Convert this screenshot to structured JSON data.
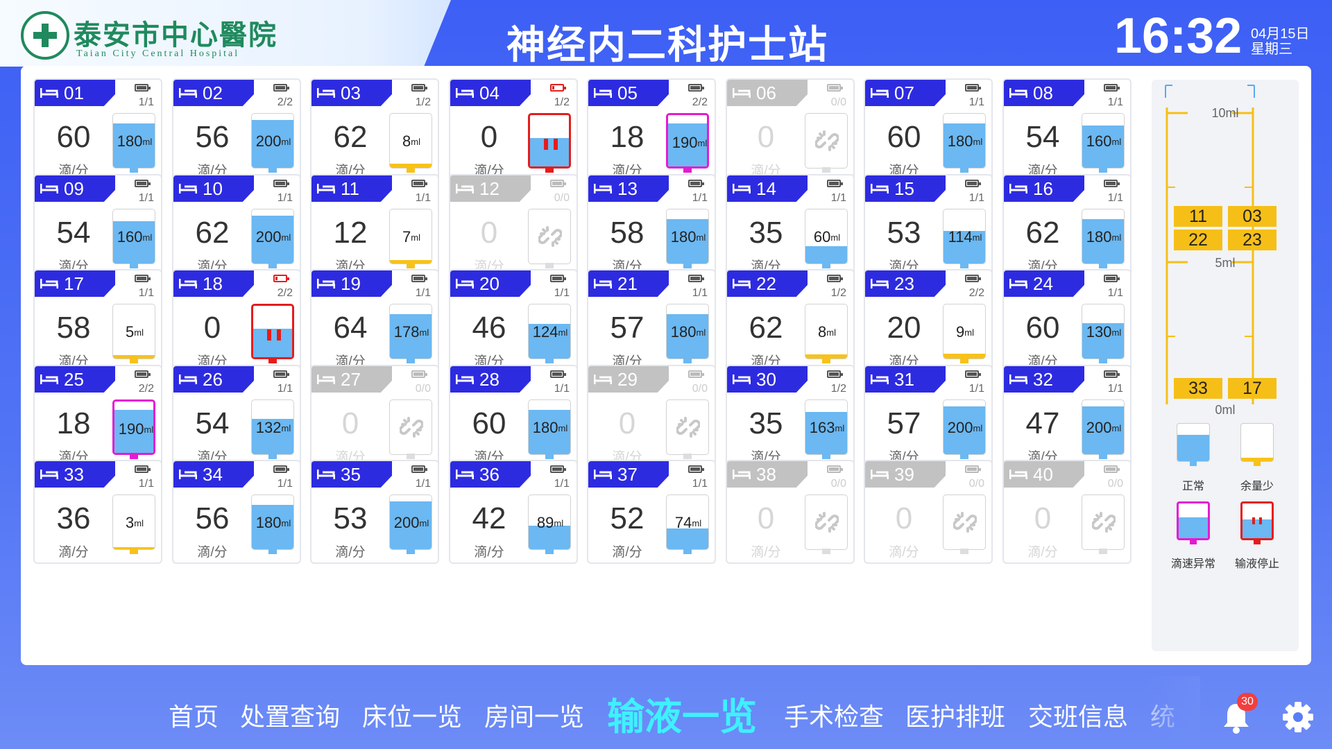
{
  "header": {
    "hospital_cn": "泰安市中心醫院",
    "hospital_en": "Taian City Central Hospital",
    "station": "神经内二科护士站",
    "time": "16:32",
    "date": "04月15日",
    "weekday": "星期三"
  },
  "rate_unit": "滴/分",
  "vol_unit": "ml",
  "beds": [
    {
      "no": "01",
      "frac": "1/1",
      "rate": "60",
      "vol": "180",
      "level": 0.82,
      "state": "normal",
      "battery": "ok"
    },
    {
      "no": "02",
      "frac": "2/2",
      "rate": "56",
      "vol": "200",
      "level": 0.88,
      "state": "normal",
      "battery": "ok"
    },
    {
      "no": "03",
      "frac": "1/2",
      "rate": "62",
      "vol": "8",
      "level": 0.08,
      "state": "low",
      "battery": "ok"
    },
    {
      "no": "04",
      "frac": "1/2",
      "rate": "0",
      "vol": "",
      "level": 0.55,
      "state": "stopped",
      "battery": "low"
    },
    {
      "no": "05",
      "frac": "2/2",
      "rate": "18",
      "vol": "190",
      "level": 0.84,
      "state": "abnormal",
      "battery": "ok"
    },
    {
      "no": "06",
      "frac": "0/0",
      "rate": "0",
      "vol": "",
      "level": 0,
      "state": "unbound",
      "battery": "off"
    },
    {
      "no": "07",
      "frac": "1/1",
      "rate": "60",
      "vol": "180",
      "level": 0.82,
      "state": "normal",
      "battery": "ok"
    },
    {
      "no": "08",
      "frac": "1/1",
      "rate": "54",
      "vol": "160",
      "level": 0.78,
      "state": "normal",
      "battery": "ok"
    },
    {
      "no": "09",
      "frac": "1/1",
      "rate": "54",
      "vol": "160",
      "level": 0.78,
      "state": "normal",
      "battery": "ok"
    },
    {
      "no": "10",
      "frac": "1/1",
      "rate": "62",
      "vol": "200",
      "level": 0.88,
      "state": "normal",
      "battery": "ok"
    },
    {
      "no": "11",
      "frac": "1/1",
      "rate": "12",
      "vol": "7",
      "level": 0.07,
      "state": "low",
      "battery": "ok"
    },
    {
      "no": "12",
      "frac": "0/0",
      "rate": "0",
      "vol": "",
      "level": 0,
      "state": "unbound",
      "battery": "off"
    },
    {
      "no": "13",
      "frac": "1/1",
      "rate": "58",
      "vol": "180",
      "level": 0.82,
      "state": "normal",
      "battery": "ok"
    },
    {
      "no": "14",
      "frac": "1/1",
      "rate": "35",
      "vol": "60",
      "level": 0.32,
      "state": "normal",
      "battery": "ok"
    },
    {
      "no": "15",
      "frac": "1/1",
      "rate": "53",
      "vol": "114",
      "level": 0.6,
      "state": "normal",
      "battery": "ok"
    },
    {
      "no": "16",
      "frac": "1/1",
      "rate": "62",
      "vol": "180",
      "level": 0.82,
      "state": "normal",
      "battery": "ok"
    },
    {
      "no": "17",
      "frac": "1/1",
      "rate": "58",
      "vol": "5",
      "level": 0.06,
      "state": "low",
      "battery": "ok"
    },
    {
      "no": "18",
      "frac": "2/2",
      "rate": "0",
      "vol": "",
      "level": 0.55,
      "state": "stopped",
      "battery": "low"
    },
    {
      "no": "19",
      "frac": "1/1",
      "rate": "64",
      "vol": "178",
      "level": 0.82,
      "state": "normal",
      "battery": "ok"
    },
    {
      "no": "20",
      "frac": "1/1",
      "rate": "46",
      "vol": "124",
      "level": 0.64,
      "state": "normal",
      "battery": "ok"
    },
    {
      "no": "21",
      "frac": "1/1",
      "rate": "57",
      "vol": "180",
      "level": 0.82,
      "state": "normal",
      "battery": "ok"
    },
    {
      "no": "22",
      "frac": "1/2",
      "rate": "62",
      "vol": "8",
      "level": 0.08,
      "state": "low",
      "battery": "ok"
    },
    {
      "no": "23",
      "frac": "2/2",
      "rate": "20",
      "vol": "9",
      "level": 0.09,
      "state": "low",
      "battery": "ok"
    },
    {
      "no": "24",
      "frac": "1/1",
      "rate": "60",
      "vol": "130",
      "level": 0.66,
      "state": "normal",
      "battery": "ok"
    },
    {
      "no": "25",
      "frac": "2/2",
      "rate": "18",
      "vol": "190",
      "level": 0.84,
      "state": "abnormal",
      "battery": "ok"
    },
    {
      "no": "26",
      "frac": "1/1",
      "rate": "54",
      "vol": "132",
      "level": 0.66,
      "state": "normal",
      "battery": "ok"
    },
    {
      "no": "27",
      "frac": "0/0",
      "rate": "0",
      "vol": "",
      "level": 0,
      "state": "unbound",
      "battery": "off"
    },
    {
      "no": "28",
      "frac": "1/1",
      "rate": "60",
      "vol": "180",
      "level": 0.82,
      "state": "normal",
      "battery": "ok"
    },
    {
      "no": "29",
      "frac": "0/0",
      "rate": "0",
      "vol": "",
      "level": 0,
      "state": "unbound",
      "battery": "off"
    },
    {
      "no": "30",
      "frac": "1/2",
      "rate": "35",
      "vol": "163",
      "level": 0.78,
      "state": "normal",
      "battery": "ok"
    },
    {
      "no": "31",
      "frac": "1/1",
      "rate": "57",
      "vol": "200",
      "level": 0.88,
      "state": "normal",
      "battery": "ok"
    },
    {
      "no": "32",
      "frac": "1/1",
      "rate": "47",
      "vol": "200",
      "level": 0.88,
      "state": "normal",
      "battery": "ok"
    },
    {
      "no": "33",
      "frac": "1/1",
      "rate": "36",
      "vol": "3",
      "level": 0.04,
      "state": "low",
      "battery": "ok"
    },
    {
      "no": "34",
      "frac": "1/1",
      "rate": "56",
      "vol": "180",
      "level": 0.82,
      "state": "normal",
      "battery": "ok"
    },
    {
      "no": "35",
      "frac": "1/1",
      "rate": "53",
      "vol": "200",
      "level": 0.88,
      "state": "normal",
      "battery": "ok"
    },
    {
      "no": "36",
      "frac": "1/1",
      "rate": "42",
      "vol": "89",
      "level": 0.44,
      "state": "normal",
      "battery": "ok"
    },
    {
      "no": "37",
      "frac": "1/1",
      "rate": "52",
      "vol": "74",
      "level": 0.38,
      "state": "normal",
      "battery": "ok"
    },
    {
      "no": "38",
      "frac": "0/0",
      "rate": "0",
      "vol": "",
      "level": 0,
      "state": "unbound",
      "battery": "off"
    },
    {
      "no": "39",
      "frac": "0/0",
      "rate": "0",
      "vol": "",
      "level": 0,
      "state": "unbound",
      "battery": "off"
    },
    {
      "no": "40",
      "frac": "0/0",
      "rate": "0",
      "vol": "",
      "level": 0,
      "state": "unbound",
      "battery": "off"
    }
  ],
  "legend": {
    "scale_top": "10ml",
    "scale_mid": "5ml",
    "scale_bottom": "0ml",
    "chips": [
      "11",
      "03",
      "22",
      "23",
      "33",
      "17"
    ],
    "normal": "正常",
    "low": "余量少",
    "abnormal": "滴速异常",
    "stopped": "输液停止"
  },
  "nav": {
    "items": [
      "首页",
      "处置查询",
      "床位一览",
      "房间一览",
      "输液一览",
      "手术检查",
      "医护排班",
      "交班信息",
      "统"
    ],
    "active_index": 4,
    "notifications": "30"
  },
  "colors": {
    "bed_header": "#2d2be0",
    "normal": "#6bb8f2",
    "low": "#f7c21b",
    "abnormal": "#e61ad0",
    "stopped": "#e51c1c",
    "nav_active": "#3ff0ff"
  }
}
